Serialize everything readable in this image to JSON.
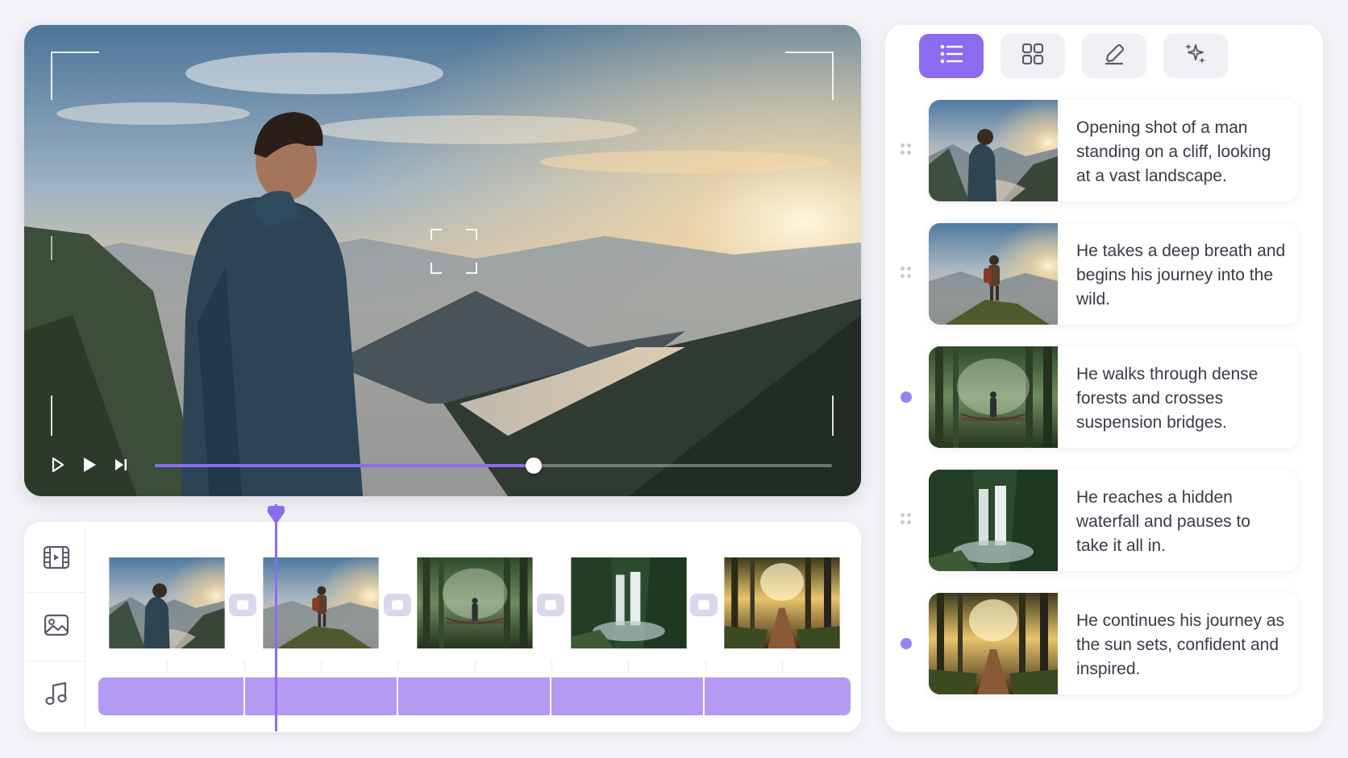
{
  "colors": {
    "accent": "#8b6cf0",
    "audio_track": "#b49af2",
    "panel_bg": "#ffffff",
    "page_bg": "#f3f3f8"
  },
  "player": {
    "controls": [
      "play-outline-icon",
      "play-icon",
      "skip-next-icon"
    ],
    "progress": 0.56
  },
  "timeline": {
    "tools": [
      "film-icon",
      "image-icon",
      "music-icon"
    ],
    "clips": [
      "scene-1",
      "scene-2",
      "scene-3",
      "scene-4",
      "scene-5"
    ],
    "playhead_position": 0.24
  },
  "storyboard": {
    "view_buttons": [
      "list-icon",
      "grid-icon",
      "edit-icon",
      "sparkle-icon"
    ],
    "active_view": "list-icon",
    "scenes": [
      {
        "text": "Opening shot of a man standing on a cliff, looking at a vast landscape.",
        "marker": "handle"
      },
      {
        "text": "He takes a deep breath and begins his journey into the wild.",
        "marker": "handle"
      },
      {
        "text": "He walks through dense forests and crosses suspension bridges.",
        "marker": "dot"
      },
      {
        "text": "He reaches a hidden waterfall and pauses to take it all in.",
        "marker": "handle"
      },
      {
        "text": "He continues his journey as the sun sets, confident and inspired.",
        "marker": "dot"
      }
    ]
  }
}
